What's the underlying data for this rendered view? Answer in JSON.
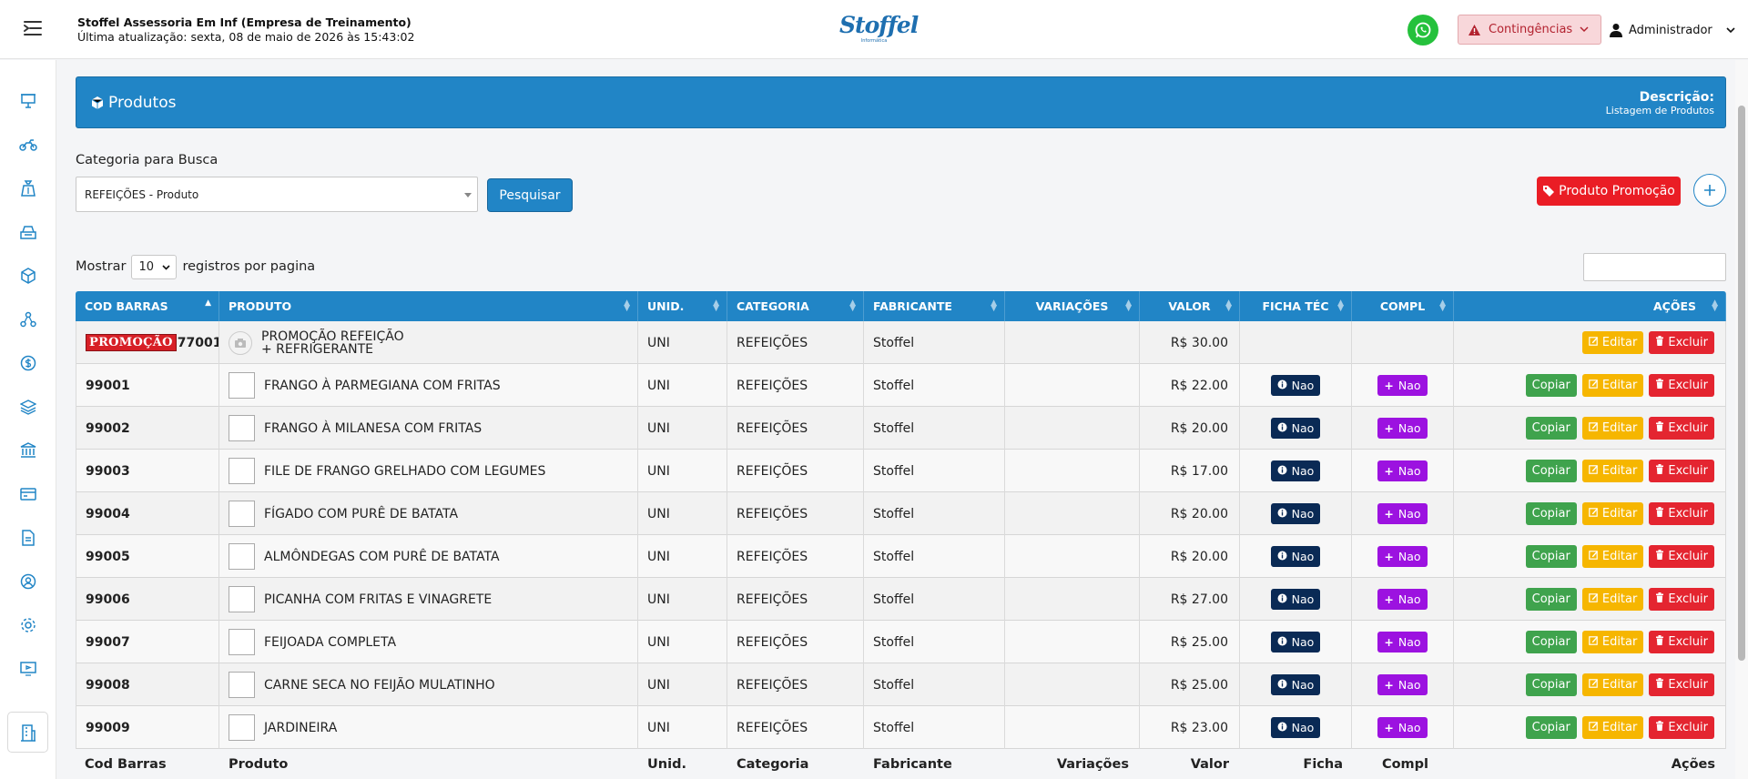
{
  "header": {
    "company_name": "Stoffel Assessoria Em Inf (Empresa de Treinamento)",
    "last_update": "Última atualização: sexta, 08 de maio de 2026 às 15:43:02",
    "logo_text": "Stoffel",
    "logo_sub": "Informática",
    "contingencias_label": "Contingências",
    "user_label": "Administrador"
  },
  "sidebar": {
    "icons": [
      "presentation-icon",
      "motorcycle-icon",
      "money-bag-icon",
      "cash-register-icon",
      "box-icon",
      "network-icon",
      "dollar-icon",
      "layers-icon",
      "bank-icon",
      "card-icon",
      "document-icon",
      "user-settings-icon",
      "gear-icon",
      "monitor-icon"
    ],
    "bottom_icon": "building-icon"
  },
  "panel": {
    "title": "Produtos",
    "desc_label": "Descrição:",
    "desc_value": "Listagem de Produtos"
  },
  "filter": {
    "category_label": "Categoria para Busca",
    "category_value": "REFEIÇÕES - Produto",
    "search_button": "Pesquisar",
    "promo_button": "Produto Promoção",
    "show_prefix": "Mostrar",
    "page_size": "10",
    "show_suffix": "registros por pagina"
  },
  "table": {
    "headers": [
      "COD BARRAS",
      "PRODUTO",
      "UNID.",
      "CATEGORIA",
      "FABRICANTE",
      "VARIAÇÕES",
      "VALOR",
      "FICHA TÉC",
      "COMPL",
      "AÇÕES"
    ],
    "footers": [
      "Cod Barras",
      "Produto",
      "Unid.",
      "Categoria",
      "Fabricante",
      "Variações",
      "Valor",
      "Ficha",
      "Compl",
      "Ações"
    ],
    "labels": {
      "promo_tag": "PROMOÇÃO",
      "no": "Nao",
      "copy": "Copiar",
      "edit": "Editar",
      "delete": "Excluir"
    },
    "rows": [
      {
        "code": "77001",
        "promo": true,
        "product": "PROMOÇÃO REFEIÇÃO + REFRIGERANTE",
        "unit": "UNI",
        "category": "REFEIÇÕES",
        "maker": "Stoffel",
        "variations": "",
        "price": "R$ 30.00",
        "ficha": false,
        "compl": false,
        "copy": false
      },
      {
        "code": "99001",
        "promo": false,
        "product": "FRANGO À PARMEGIANA COM FRITAS",
        "unit": "UNI",
        "category": "REFEIÇÕES",
        "maker": "Stoffel",
        "variations": "",
        "price": "R$ 22.00",
        "ficha": true,
        "compl": true,
        "copy": true
      },
      {
        "code": "99002",
        "promo": false,
        "product": "FRANGO À MILANESA COM FRITAS",
        "unit": "UNI",
        "category": "REFEIÇÕES",
        "maker": "Stoffel",
        "variations": "",
        "price": "R$ 20.00",
        "ficha": true,
        "compl": true,
        "copy": true
      },
      {
        "code": "99003",
        "promo": false,
        "product": "FILE DE FRANGO GRELHADO COM LEGUMES",
        "unit": "UNI",
        "category": "REFEIÇÕES",
        "maker": "Stoffel",
        "variations": "",
        "price": "R$ 17.00",
        "ficha": true,
        "compl": true,
        "copy": true
      },
      {
        "code": "99004",
        "promo": false,
        "product": "FÍGADO COM PURÊ DE BATATA",
        "unit": "UNI",
        "category": "REFEIÇÕES",
        "maker": "Stoffel",
        "variations": "",
        "price": "R$ 20.00",
        "ficha": true,
        "compl": true,
        "copy": true
      },
      {
        "code": "99005",
        "promo": false,
        "product": "ALMÔNDEGAS COM PURÊ DE BATATA",
        "unit": "UNI",
        "category": "REFEIÇÕES",
        "maker": "Stoffel",
        "variations": "",
        "price": "R$ 20.00",
        "ficha": true,
        "compl": true,
        "copy": true
      },
      {
        "code": "99006",
        "promo": false,
        "product": "PICANHA COM FRITAS E VINAGRETE",
        "unit": "UNI",
        "category": "REFEIÇÕES",
        "maker": "Stoffel",
        "variations": "",
        "price": "R$ 27.00",
        "ficha": true,
        "compl": true,
        "copy": true
      },
      {
        "code": "99007",
        "promo": false,
        "product": "FEIJOADA COMPLETA",
        "unit": "UNI",
        "category": "REFEIÇÕES",
        "maker": "Stoffel",
        "variations": "",
        "price": "R$ 25.00",
        "ficha": true,
        "compl": true,
        "copy": true
      },
      {
        "code": "99008",
        "promo": false,
        "product": "CARNE SECA NO FEIJÃO MULATINHO",
        "unit": "UNI",
        "category": "REFEIÇÕES",
        "maker": "Stoffel",
        "variations": "",
        "price": "R$ 25.00",
        "ficha": true,
        "compl": true,
        "copy": true
      },
      {
        "code": "99009",
        "promo": false,
        "product": "JARDINEIRA",
        "unit": "UNI",
        "category": "REFEIÇÕES",
        "maker": "Stoffel",
        "variations": "",
        "price": "R$ 23.00",
        "ficha": true,
        "compl": true,
        "copy": true
      }
    ]
  },
  "colors": {
    "primary": "#2185c6",
    "promo_red": "#ea1d25",
    "ficha_badge": "#0a2a55",
    "compl_badge": "#9c12e0",
    "copy_green": "#3fa34d",
    "edit_yellow": "#f6b600",
    "delete_red": "#e42530",
    "whatsapp_green": "#25c13c"
  }
}
